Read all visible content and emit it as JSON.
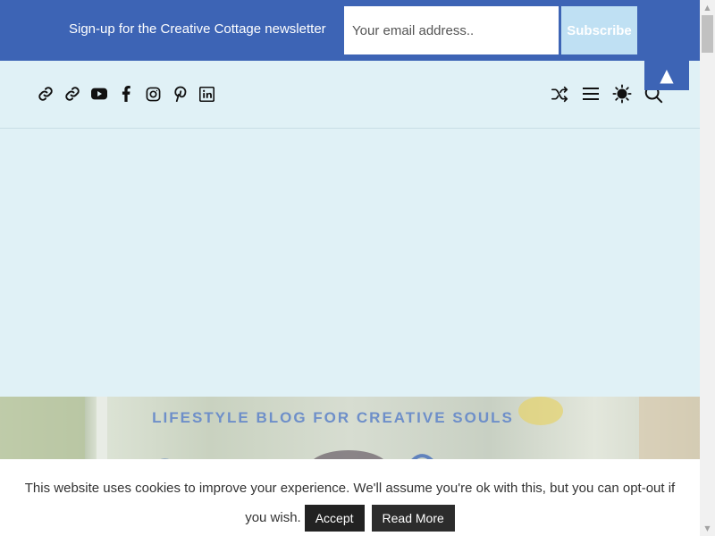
{
  "newsletter": {
    "text": "Sign-up for the Creative Cottage newsletter",
    "email_placeholder": "Your email address..",
    "subscribe_label": "Subscribe",
    "background_color": "#3d64b5"
  },
  "back_to_top": {
    "label": "▲"
  },
  "header": {
    "social_icons": [
      "link-icon",
      "link-icon",
      "youtube-icon",
      "facebook-icon",
      "instagram-icon",
      "pinterest-icon",
      "linkedin-icon"
    ],
    "tool_icons": [
      "shuffle-icon",
      "menu-icon",
      "sun-icon",
      "search-icon"
    ],
    "background_color": "#e0f1f6"
  },
  "hero": {
    "tagline": "LIFESTYLE BLOG FOR CREATIVE SOULS"
  },
  "cookie_banner": {
    "text": "This website uses cookies to improve your experience. We'll assume you're ok with this, but you can opt-out if you wish.",
    "accept_label": "Accept",
    "read_more_label": "Read More"
  },
  "scrollbar": {
    "up": "▲",
    "down": "▼"
  }
}
